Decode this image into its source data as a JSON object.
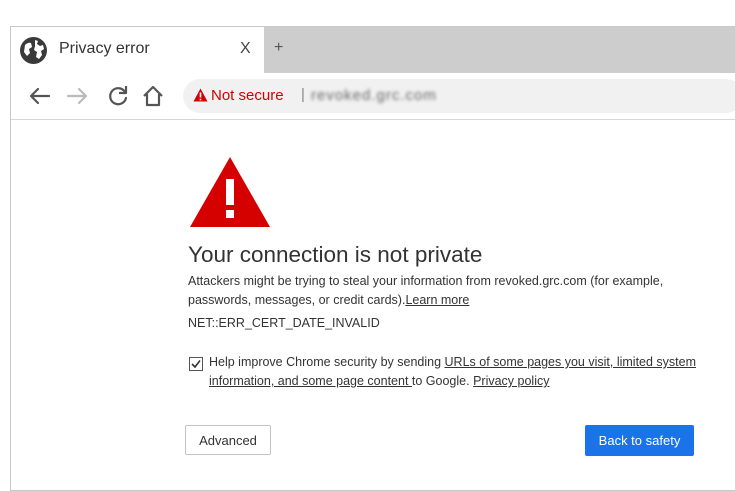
{
  "tab": {
    "title": "Privacy error",
    "close_label": "X",
    "new_tab_label": "+"
  },
  "address_bar": {
    "security_label": "Not secure",
    "separator": "|",
    "url": "revoked.grc.com"
  },
  "interstitial": {
    "headline": "Your connection is not private",
    "description": "Attackers might be trying to steal your information from revoked.grc.com (for example, passwords, messages, or credit cards).",
    "learn_more": "Learn more",
    "error_code": "NET::ERR_CERT_DATE_INVALID",
    "consent": {
      "checked": true,
      "prefix": "Help improve Chrome security by sending ",
      "link": "URLs of some pages you visit, limited system information, and some page content ",
      "middle": " to Google. ",
      "privacy_link": "Privacy policy"
    },
    "advanced_button": "Advanced",
    "back_button": "Back to safety"
  },
  "colors": {
    "warning_red": "#d50000",
    "primary_blue": "#1a73e8",
    "tabstrip": "#cdcdcd"
  },
  "icons": [
    "globe-icon",
    "back-arrow-icon",
    "forward-arrow-icon",
    "reload-icon",
    "home-icon",
    "warning-triangle-icon",
    "checkmark-icon"
  ]
}
